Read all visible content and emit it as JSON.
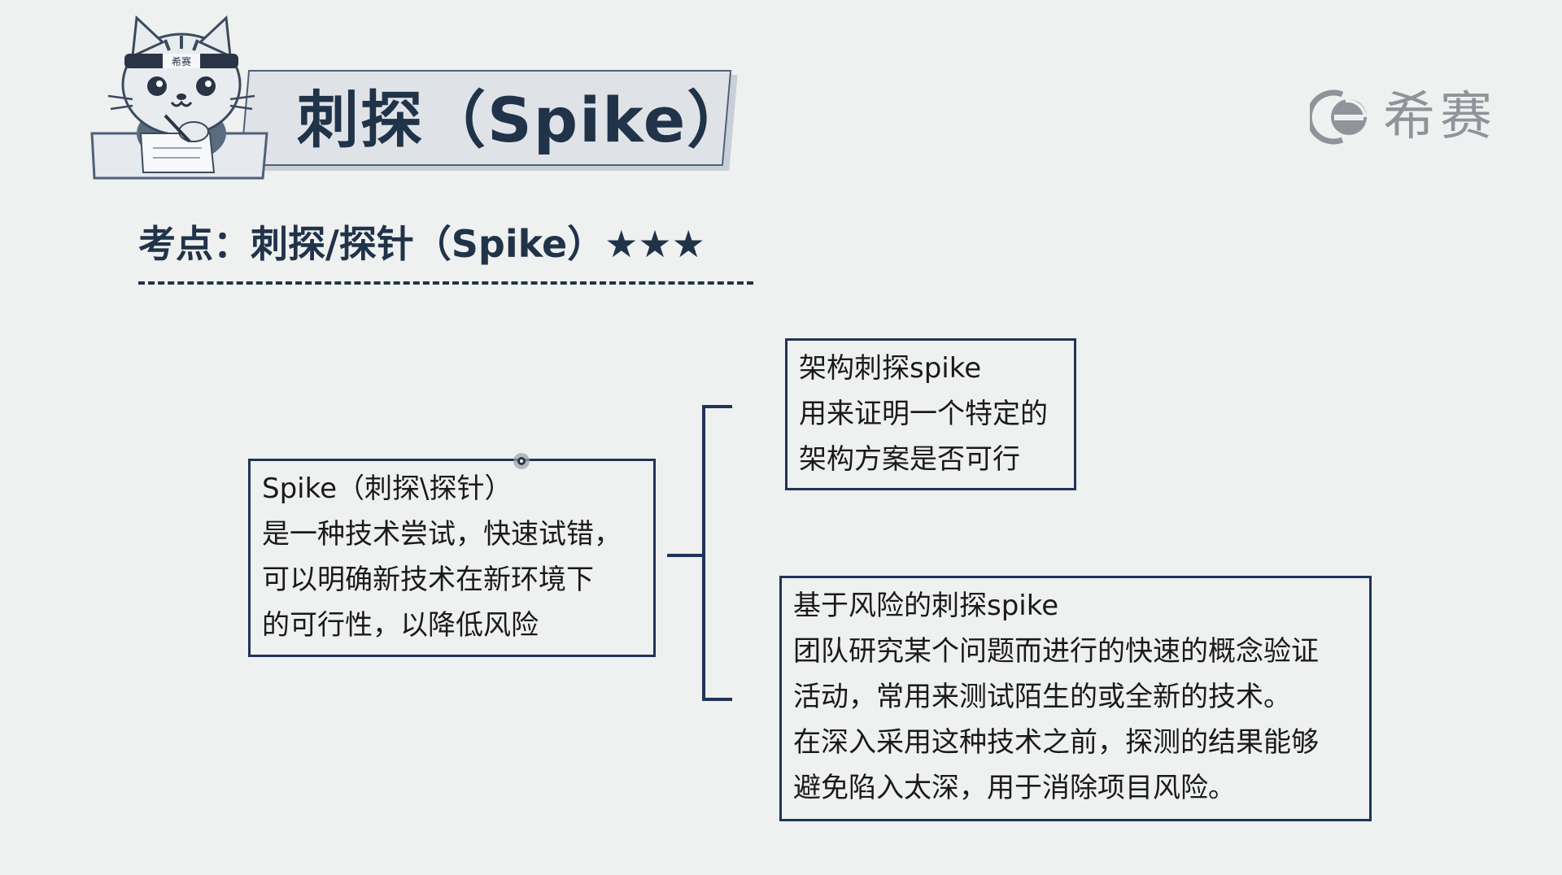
{
  "header": {
    "title": "刺探（Spike）",
    "mascot_badge": "希赛"
  },
  "brand": {
    "logo_text": "希赛",
    "icon": "e-circle-logo-icon"
  },
  "keypoint": {
    "text": "考点：刺探/探针（Spike）★★★"
  },
  "main_box": {
    "lines": [
      "Spike（刺探\\探针）",
      "是一种技术尝试，快速试错，",
      "可以明确新技术在新环境下",
      "的可行性，以降低风险"
    ]
  },
  "arch_box": {
    "lines": [
      "架构刺探spike",
      "用来证明一个特定的",
      "架构方案是否可行"
    ]
  },
  "risk_box": {
    "lines": [
      "基于风险的刺探spike",
      "团队研究某个问题而进行的快速的概念验证",
      "活动，常用来测试陌生的或全新的技术。",
      "在深入采用这种技术之前，探测的结果能够",
      "避免陷入太深，用于消除项目风险。"
    ]
  },
  "colors": {
    "background": "#eff1f0",
    "navy": "#1f3458",
    "title_text": "#213349",
    "logo_gray": "#8f949b"
  }
}
